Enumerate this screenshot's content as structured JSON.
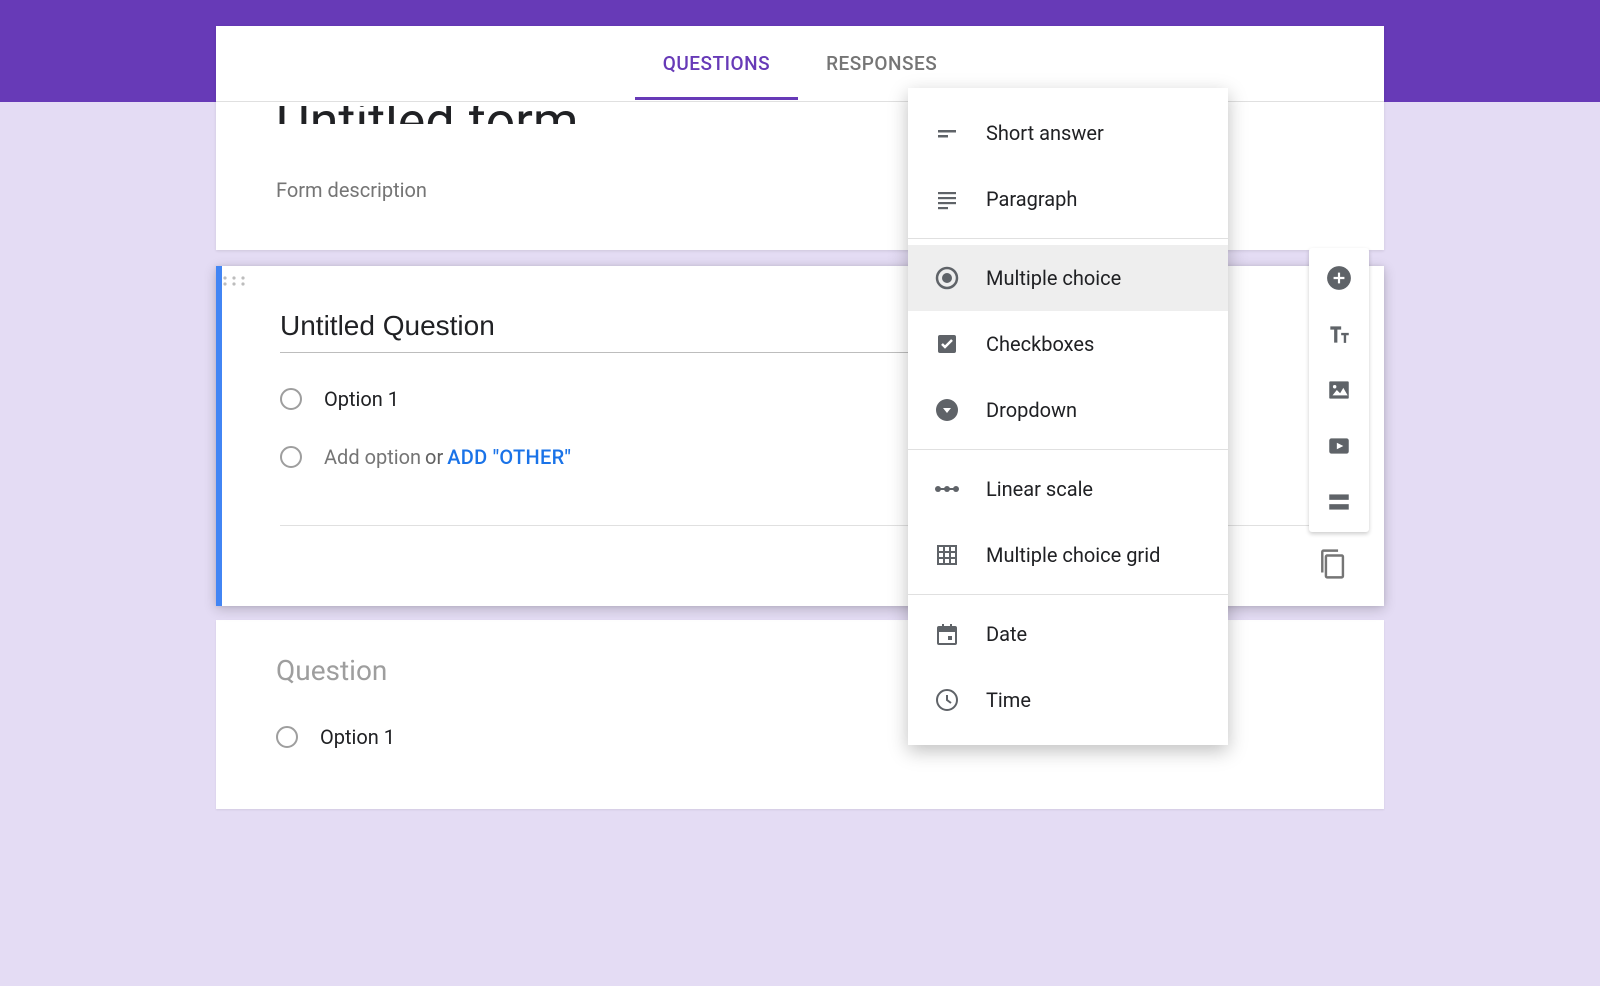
{
  "tabs": {
    "questions": "QUESTIONS",
    "responses": "RESPONSES"
  },
  "form": {
    "title_partial": "Untitled form",
    "description_placeholder": "Form description"
  },
  "active_question": {
    "title": "Untitled Question",
    "option1": "Option 1",
    "add_option_placeholder": "Add option",
    "or_text": "or",
    "add_other_label": "ADD \"OTHER\""
  },
  "secondary_question": {
    "title": "Question",
    "option1": "Option 1"
  },
  "question_type_menu": {
    "short_answer": "Short answer",
    "paragraph": "Paragraph",
    "multiple_choice": "Multiple choice",
    "checkboxes": "Checkboxes",
    "dropdown": "Dropdown",
    "linear_scale": "Linear scale",
    "mc_grid": "Multiple choice grid",
    "date": "Date",
    "time": "Time"
  }
}
